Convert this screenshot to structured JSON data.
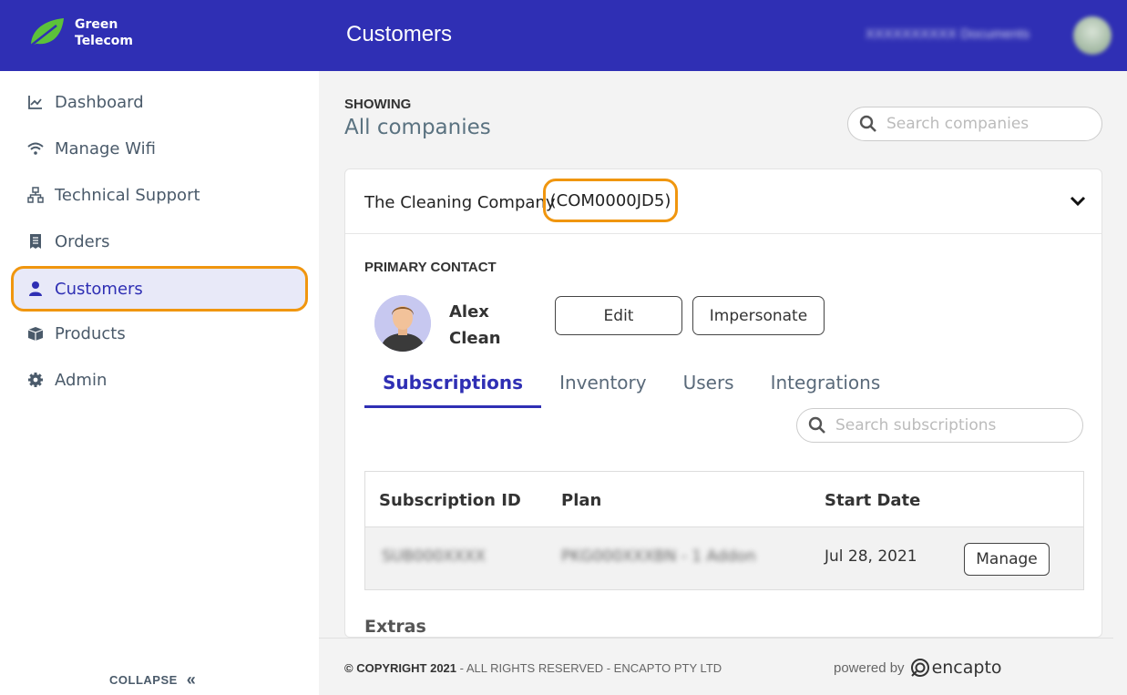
{
  "brand": {
    "line1": "Green",
    "line2": "Telecom",
    "icon": "leaf-logo-icon",
    "accent": "#2f2fb4",
    "leaf_color": "#5cc23a"
  },
  "header": {
    "title": "Customers",
    "user_text": "XXXXXXXXXX Documents",
    "avatar_icon": "user-avatar-icon"
  },
  "sidebar": {
    "items": [
      {
        "label": "Dashboard",
        "icon": "chart-line-icon"
      },
      {
        "label": "Manage Wifi",
        "icon": "wifi-icon"
      },
      {
        "label": "Technical Support",
        "icon": "network-icon"
      },
      {
        "label": "Orders",
        "icon": "receipt-icon"
      },
      {
        "label": "Customers",
        "icon": "user-icon",
        "active": true
      },
      {
        "label": "Products",
        "icon": "box-icon"
      },
      {
        "label": "Admin",
        "icon": "gear-icon"
      }
    ],
    "collapse_label": "COLLAPSE",
    "collapse_glyph": "«"
  },
  "main": {
    "showing_label": "SHOWING",
    "showing_value": "All companies",
    "search_companies_placeholder": "Search companies",
    "company": {
      "name": "The Cleaning Company",
      "id": "(COM0000JD5)",
      "primary_contact_label": "PRIMARY CONTACT",
      "contact_first": "Alex",
      "contact_last": "Clean",
      "edit_label": "Edit",
      "impersonate_label": "Impersonate",
      "tabs": [
        "Subscriptions",
        "Inventory",
        "Users",
        "Integrations"
      ],
      "active_tab": "Subscriptions",
      "search_subscriptions_placeholder": "Search subscriptions",
      "table": {
        "headers": [
          "Subscription ID",
          "Plan",
          "Start Date"
        ],
        "rows": [
          {
            "id": "SUB000XXXX",
            "plan": "PKG000XXXBN - 1 Addon",
            "start_date": "Jul 28, 2021",
            "action": "Manage"
          }
        ]
      },
      "extras_label": "Extras"
    }
  },
  "footer": {
    "copyright_bold": "© COPYRIGHT 2021",
    "copyright_rest": " - ALL RIGHTS RESERVED - ENCAPTO PTY LTD",
    "powered_by": "powered by",
    "powered_brand": "encapto"
  }
}
